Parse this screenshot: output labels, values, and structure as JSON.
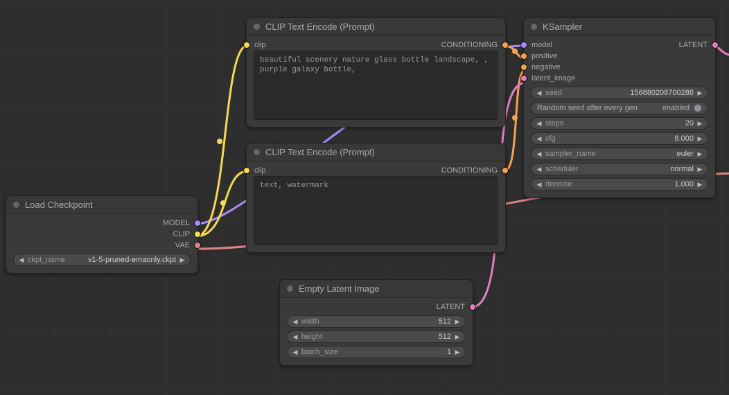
{
  "colors": {
    "model": "#a88cff",
    "clip": "#f7d94c",
    "vae": "#e08383",
    "conditioning": "#f7a24c",
    "latent": "#e07fc0"
  },
  "load_checkpoint": {
    "title": "Load Checkpoint",
    "outputs": {
      "model": "MODEL",
      "clip": "CLIP",
      "vae": "VAE"
    },
    "widget": {
      "label": "ckpt_name",
      "value": "v1-5-pruned-emaonly.ckpt"
    }
  },
  "clip_positive": {
    "title": "CLIP Text Encode (Prompt)",
    "input": "clip",
    "output": "CONDITIONING",
    "text": "beautiful scenery nature glass bottle landscape, , purple galaxy bottle,"
  },
  "clip_negative": {
    "title": "CLIP Text Encode (Prompt)",
    "input": "clip",
    "output": "CONDITIONING",
    "text": "text, watermark"
  },
  "empty_latent": {
    "title": "Empty Latent Image",
    "output": "LATENT",
    "widgets": {
      "width": {
        "label": "width",
        "value": "512"
      },
      "height": {
        "label": "height",
        "value": "512"
      },
      "batch": {
        "label": "batch_size",
        "value": "1"
      }
    }
  },
  "ksampler": {
    "title": "KSampler",
    "inputs": {
      "model": "model",
      "positive": "positive",
      "negative": "negative",
      "latent": "latent_image"
    },
    "output": "LATENT",
    "widgets": {
      "seed": {
        "label": "seed",
        "value": "156680208700286"
      },
      "random": {
        "label": "Random seed after every gen",
        "value": "enabled"
      },
      "steps": {
        "label": "steps",
        "value": "20"
      },
      "cfg": {
        "label": "cfg",
        "value": "8.000"
      },
      "sampler": {
        "label": "sampler_name",
        "value": "euler"
      },
      "sched": {
        "label": "scheduler",
        "value": "normal"
      },
      "denoise": {
        "label": "denoise",
        "value": "1.000"
      }
    }
  }
}
